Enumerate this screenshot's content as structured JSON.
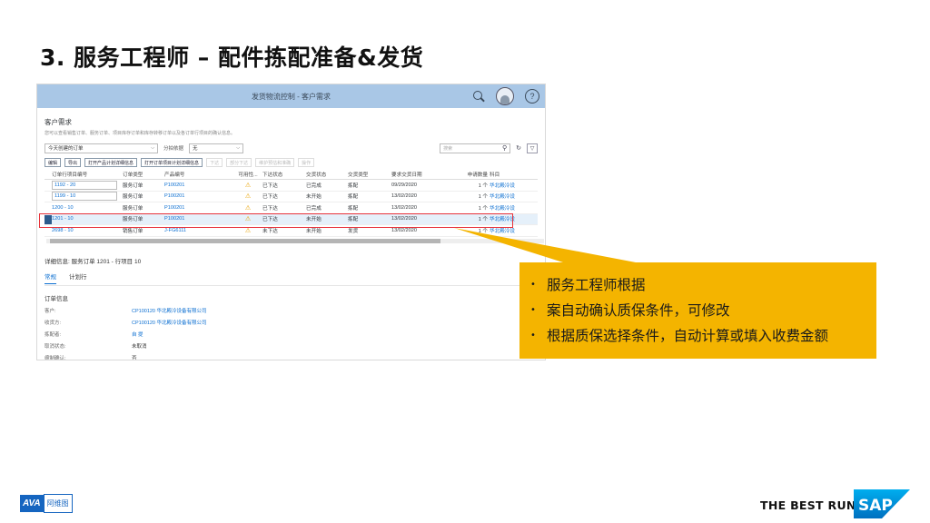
{
  "slide": {
    "title": "3. 服务工程师 – 配件拣配准备&发货"
  },
  "app": {
    "shell_title": "发货物流控制 - 客户需求",
    "help_glyph": "?",
    "page_heading": "客户需求",
    "page_description": "您可以查看销售订单、服务订单、项目库存订单和库存转移订单以及各订单行项目的确认信息。",
    "filters": {
      "variant": "今天创建的订单",
      "assign_label": "分拍依据",
      "assign_value": "无",
      "search_placeholder": "搜索",
      "search_glyph": "🔍",
      "refresh_glyph": "↻",
      "filter_glyph": "▽"
    },
    "toolbar": [
      {
        "label": "编辑",
        "enabled": true
      },
      {
        "label": "导出",
        "enabled": true
      },
      {
        "label": "打开产品计划详细信息",
        "enabled": true
      },
      {
        "label": "打开订单项目计划详细信息",
        "enabled": true
      },
      {
        "label": "下达",
        "enabled": false
      },
      {
        "label": "部分下达",
        "enabled": false
      },
      {
        "label": "维护预估和准确",
        "enabled": false
      },
      {
        "label": "操作",
        "enabled": false
      }
    ],
    "table": {
      "columns": [
        "订单行项目编号",
        "订单类型",
        "产品编号",
        "可用性...",
        "下达状态",
        "交货状态",
        "交货类型",
        "要求交货日期",
        "申请数量",
        "科目"
      ],
      "rows": [
        {
          "id": "1192 - 20",
          "type": "服务订单",
          "product": "P100201",
          "avail": "⚠",
          "release": "已下达",
          "delivery": "已完成",
          "dtype": "拣配",
          "date": "09/29/2020",
          "qty": "1 个",
          "account": "华北殿冷设"
        },
        {
          "id": "1199 - 10",
          "type": "服务订单",
          "product": "P100201",
          "avail": "⚠",
          "release": "已下达",
          "delivery": "未开始",
          "dtype": "拣配",
          "date": "13/02/2020",
          "qty": "1 个",
          "account": "华北殿冷设"
        },
        {
          "id": "1200 - 10",
          "type": "服务订单",
          "product": "P100201",
          "avail": "⚠",
          "release": "已下达",
          "delivery": "已完成",
          "dtype": "拣配",
          "date": "13/02/2020",
          "qty": "1 个",
          "account": "华北殿冷设"
        },
        {
          "id": "1201 - 10",
          "type": "服务订单",
          "product": "P100201",
          "avail": "⚠",
          "release": "已下达",
          "delivery": "未开始",
          "dtype": "拣配",
          "date": "13/02/2020",
          "qty": "1 个",
          "account": "华北殿冷设"
        },
        {
          "id": "2698 - 10",
          "type": "销售订单",
          "product": "J-FG6111",
          "avail": "⚠",
          "release": "未下达",
          "delivery": "未开始",
          "dtype": "发货",
          "date": "13/02/2020",
          "qty": "1 个",
          "account": "华北殿冷设"
        }
      ]
    },
    "detail": {
      "title": "详细信息: 服务订单 1201 - 行项目 10",
      "tabs": [
        "常规",
        "计划行"
      ],
      "section": "订单信息",
      "fields": [
        {
          "label": "客户:",
          "value": "CP100120 华北殿冷设备有限公司",
          "link": true
        },
        {
          "label": "收货方:",
          "value": "CP100120 华北殿冷设备有限公司",
          "link": true
        },
        {
          "label": "拣配者:",
          "value": "自 提",
          "link": true
        },
        {
          "label": "取消状态:",
          "value": "未取消",
          "link": false
        },
        {
          "label": "缩制确认:",
          "value": "否",
          "link": false
        }
      ]
    }
  },
  "callout": {
    "bullet_glyph": "•",
    "bullets": [
      "服务工程师根据",
      "案自动确认质保条件，可修改",
      "根据质保选择条件，自动计算或填入收费金额"
    ],
    "color": "#f4b400"
  },
  "footer": {
    "ava_mark": "AVA",
    "ava_text": "阿维图",
    "tagline": "THE BEST RUN",
    "sap_text": "SAP"
  }
}
